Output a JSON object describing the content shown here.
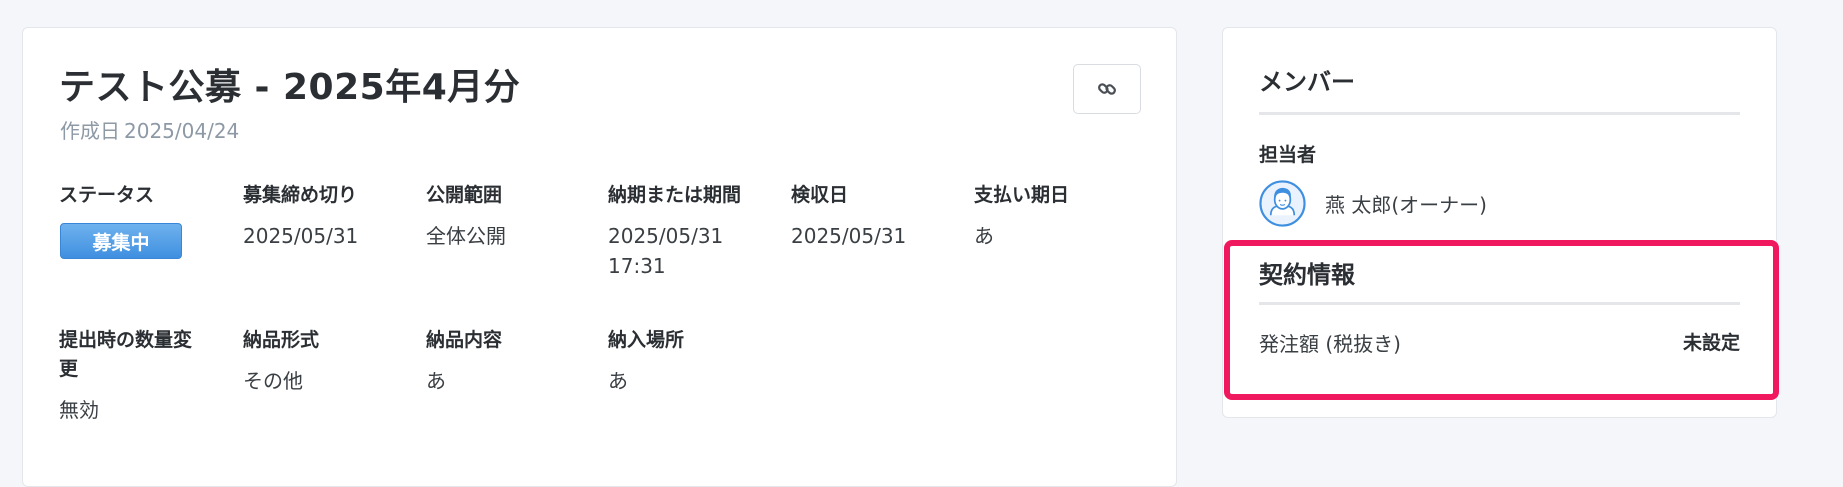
{
  "project": {
    "title": "テスト公募 - 2025年4月分",
    "created_label": "作成日",
    "created_date": "2025/04/24"
  },
  "fields": {
    "status": {
      "label": "ステータス",
      "value": "募集中"
    },
    "deadline": {
      "label": "募集締め切り",
      "value": "2025/05/31"
    },
    "visibility": {
      "label": "公開範囲",
      "value": "全体公開"
    },
    "delivery_period": {
      "label": "納期または期間",
      "value_line1": "2025/05/31",
      "value_line2": "17:31"
    },
    "inspection_date": {
      "label": "検収日",
      "value": "2025/05/31"
    },
    "payment_date": {
      "label": "支払い期日",
      "value": "あ"
    },
    "quantity_change": {
      "label_line1": "提出時の数量変",
      "label_line2": "更",
      "value": "無効"
    },
    "delivery_format": {
      "label": "納品形式",
      "value": "その他"
    },
    "delivery_content": {
      "label": "納品内容",
      "value": "あ"
    },
    "delivery_place": {
      "label": "納入場所",
      "value": "あ"
    }
  },
  "members": {
    "title": "メンバー",
    "assignee_label": "担当者",
    "assignee_name": "燕 太郎(オーナー)"
  },
  "contract": {
    "title": "契約情報",
    "order_amount_label": "発注額 (税抜き)",
    "order_amount_value": "未設定"
  },
  "colors": {
    "status_badge": "#4a98e6",
    "highlight": "#f0185e",
    "muted_text": "#8e99a6"
  },
  "icons": {
    "copy_link": "link-icon",
    "avatar": "user-avatar-icon"
  }
}
